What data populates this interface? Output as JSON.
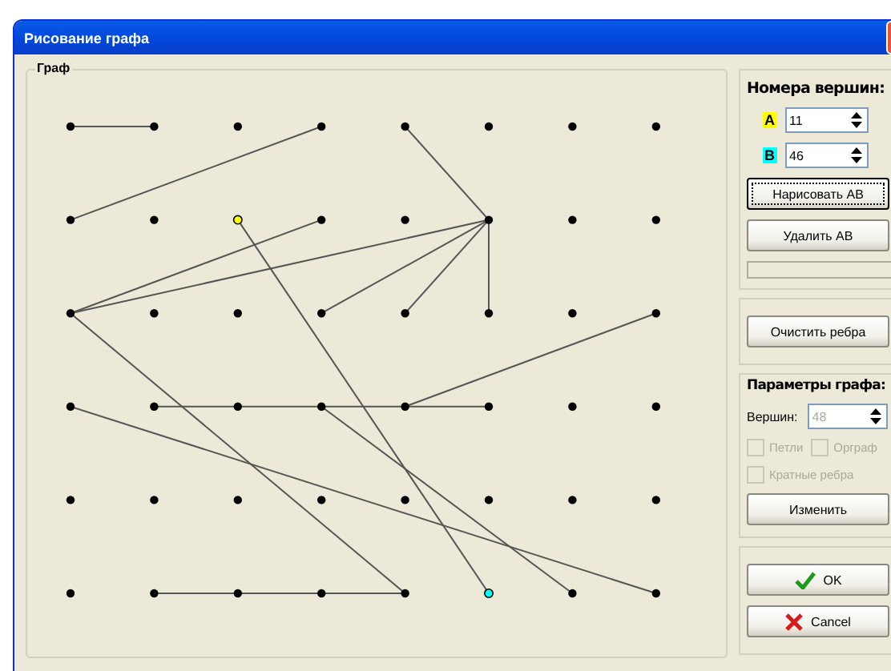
{
  "window": {
    "title": "Рисование графа"
  },
  "graph": {
    "title": "Граф"
  },
  "vertex_numbers": {
    "title": "Номера вершин:",
    "fields": [
      {
        "label": "A",
        "value": "11",
        "color": "#ffff00"
      },
      {
        "label": "B",
        "value": "46",
        "color": "#00ffff"
      }
    ],
    "buttons": [
      {
        "label": "Нарисовать АВ",
        "focused": true
      },
      {
        "label": "Удалить АВ",
        "focused": false
      }
    ]
  },
  "clear_button": "Очистить ребра",
  "params": {
    "title": "Параметры графа:",
    "vertices_label": "Вершин:",
    "vertices_value": "48",
    "disabled": true,
    "checkboxes": [
      {
        "label": "Петли",
        "checked": false
      },
      {
        "label": "Орграф",
        "checked": false
      },
      {
        "label": "Кратные ребра",
        "checked": false
      }
    ],
    "apply_button": "Изменить"
  },
  "ok_button": "OK",
  "cancel_button": "Cancel"
}
